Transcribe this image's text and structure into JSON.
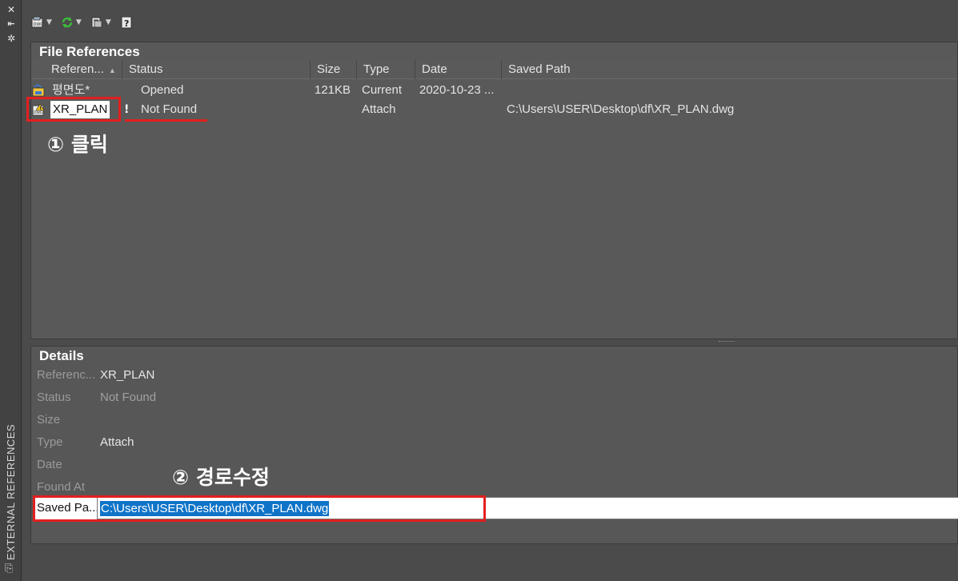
{
  "strip": {
    "title": "EXTERNAL REFERENCES",
    "close_glyph": "✕",
    "pin_glyph": "⇤",
    "settings_glyph": "✲",
    "bottom_glyph": "⎘"
  },
  "toolbar": {
    "items": [
      {
        "icon": "attach-dwg-icon"
      },
      {
        "icon": "refresh-icon"
      },
      {
        "icon": "change-path-icon"
      },
      {
        "icon": "help-icon",
        "glyph": "?"
      }
    ]
  },
  "file_references": {
    "title": "File References",
    "columns": [
      "Referen...",
      "Status",
      "Size",
      "Type",
      "Date",
      "Saved Path"
    ],
    "rows": [
      {
        "icon": "drawing-icon",
        "reference": "평면도*",
        "status": "Opened",
        "size": "121KB",
        "type": "Current",
        "date": "2020-10-23 ...",
        "saved_path": "",
        "warning": ""
      },
      {
        "icon": "xref-warning-icon",
        "reference": "XR_PLAN",
        "status": "Not Found",
        "size": "",
        "type": "Attach",
        "date": "",
        "saved_path": "C:\\Users\\USER\\Desktop\\df\\XR_PLAN.dwg",
        "warning": "!"
      }
    ]
  },
  "annotations": {
    "step1": "① 클릭",
    "step2": "② 경로수정"
  },
  "details": {
    "title": "Details",
    "fields": [
      {
        "label": "Referenc...",
        "value": "XR_PLAN"
      },
      {
        "label": "Status",
        "value": "Not Found"
      },
      {
        "label": "Size",
        "value": ""
      },
      {
        "label": "Type",
        "value": "Attach"
      },
      {
        "label": "Date",
        "value": ""
      },
      {
        "label": "Found At",
        "value": ""
      }
    ],
    "saved_path_label": "Saved Pa...",
    "saved_path_value": "C:\\Users\\USER\\Desktop\\df\\XR_PLAN.dwg"
  },
  "colors": {
    "highlight_red": "#e31f1f",
    "selection_blue": "#0f74c8",
    "panel_bg": "#595959"
  }
}
